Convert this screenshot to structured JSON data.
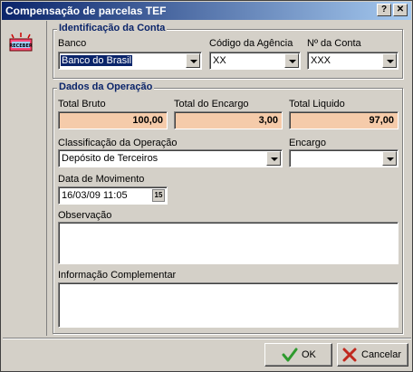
{
  "window": {
    "title": "Compensação de  parcelas TEF",
    "help_label": "?",
    "close_label": "✕"
  },
  "logo": {
    "text": "RECEBER"
  },
  "identificacao": {
    "title": "Identificação da Conta",
    "banco_label": "Banco",
    "banco_value": "Banco do Brasil",
    "agencia_label": "Código da Agência",
    "agencia_value": "XX",
    "conta_label": "Nº da Conta",
    "conta_value": "XXX"
  },
  "dados": {
    "title": "Dados da Operação",
    "total_bruto_label": "Total Bruto",
    "total_bruto_value": "100,00",
    "total_encargo_label": "Total do Encargo",
    "total_encargo_value": "3,00",
    "total_liquido_label": "Total Liquido",
    "total_liquido_value": "97,00",
    "classificacao_label": "Classificação da Operação",
    "classificacao_value": "Depósito de Terceiros",
    "encargo_label": "Encargo",
    "encargo_value": "",
    "data_label": "Data de Movimento",
    "data_value": "16/03/09 11:05",
    "cal_label": "15",
    "observacao_label": "Observação",
    "observacao_value": "",
    "info_label": "Informação Complementar",
    "info_value": ""
  },
  "buttons": {
    "ok_label": "OK",
    "cancel_label": "Cancelar"
  },
  "colors": {
    "title_start": "#0a246a",
    "group_title": "#0a246a",
    "numeric_bg": "#f5cbaa",
    "ok_icon": "#2e9a2e",
    "cancel_icon": "#c0281e"
  }
}
